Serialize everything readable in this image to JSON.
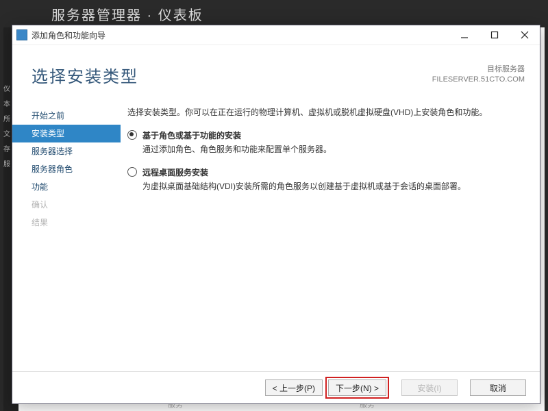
{
  "bg": {
    "title": "服务器管理器 · 仪表板",
    "side": [
      "仪",
      "本",
      "所",
      "文",
      "存",
      "服"
    ],
    "footer_word": "服务"
  },
  "window": {
    "title": "添加角色和功能向导"
  },
  "header": {
    "heading": "选择安装类型",
    "target_label": "目标服务器",
    "target_value": "FILESERVER.51CTO.COM"
  },
  "nav": {
    "items": [
      {
        "label": "开始之前",
        "state": "enabled"
      },
      {
        "label": "安装类型",
        "state": "selected"
      },
      {
        "label": "服务器选择",
        "state": "enabled"
      },
      {
        "label": "服务器角色",
        "state": "enabled"
      },
      {
        "label": "功能",
        "state": "enabled"
      },
      {
        "label": "确认",
        "state": "disabled"
      },
      {
        "label": "结果",
        "state": "disabled"
      }
    ]
  },
  "content": {
    "intro": "选择安装类型。你可以在正在运行的物理计算机、虚拟机或脱机虚拟硬盘(VHD)上安装角色和功能。",
    "options": [
      {
        "title": "基于角色或基于功能的安装",
        "desc": "通过添加角色、角色服务和功能来配置单个服务器。",
        "selected": true
      },
      {
        "title": "远程桌面服务安装",
        "desc": "为虚拟桌面基础结构(VDI)安装所需的角色服务以创建基于虚拟机或基于会话的桌面部署。",
        "selected": false
      }
    ]
  },
  "buttons": {
    "prev": "< 上一步(P)",
    "next": "下一步(N) >",
    "install": "安装(I)",
    "cancel": "取消"
  }
}
